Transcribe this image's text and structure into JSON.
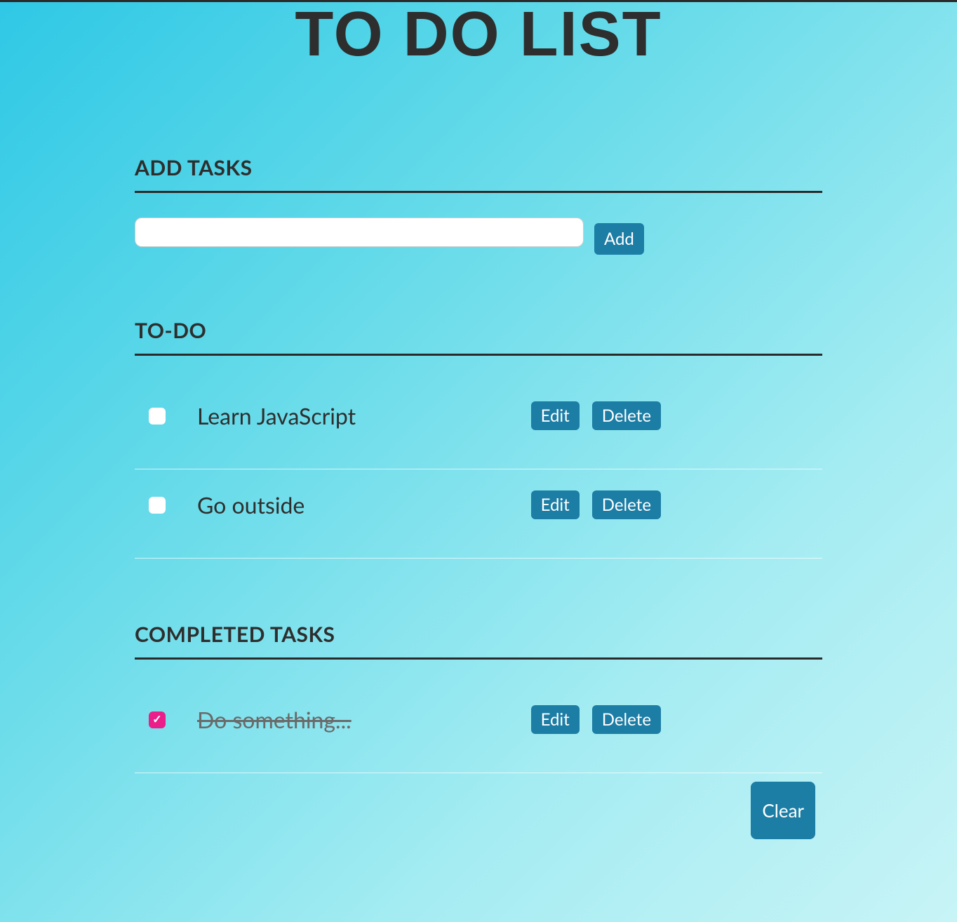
{
  "title": "TO DO LIST",
  "sections": {
    "add": {
      "title": "ADD TASKS",
      "input_value": "",
      "add_button": "Add"
    },
    "todo": {
      "title": "TO-DO",
      "items": [
        {
          "text": "Learn JavaScript",
          "checked": false
        },
        {
          "text": "Go outside",
          "checked": false
        }
      ]
    },
    "completed": {
      "title": "COMPLETED TASKS",
      "items": [
        {
          "text": "Do something...",
          "checked": true
        }
      ],
      "clear_button": "Clear"
    }
  },
  "buttons": {
    "edit": "Edit",
    "delete": "Delete"
  },
  "colors": {
    "button_bg": "#1c7da5",
    "checkbox_checked": "#eb1f8a",
    "text": "#2e2e2e"
  }
}
